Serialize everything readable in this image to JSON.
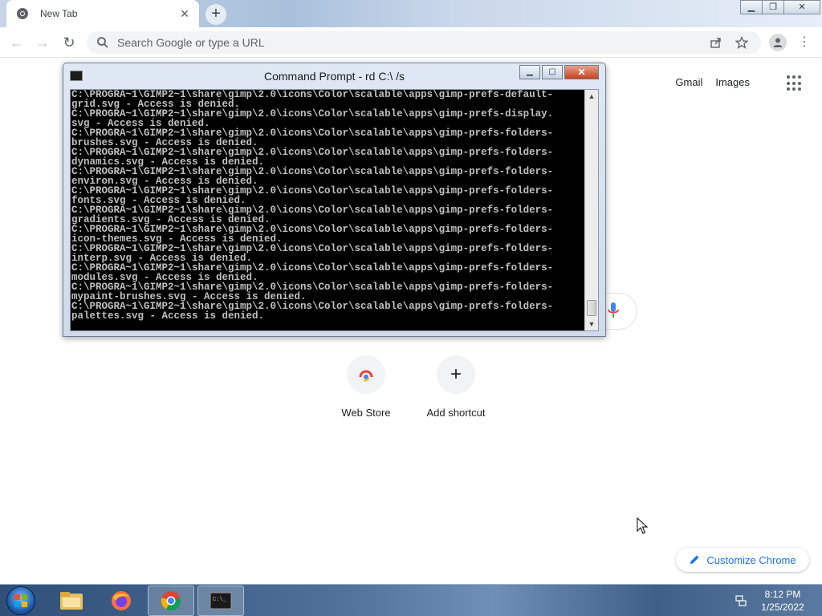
{
  "browser": {
    "tab": {
      "title": "New Tab"
    },
    "omnibox": {
      "placeholder": "Search Google or type a URL"
    },
    "colors": {
      "accent": "#1a73e8",
      "tab_bg": "#ffffff",
      "omnibox_bg": "#f1f3f4"
    }
  },
  "ntp": {
    "links": {
      "gmail": "Gmail",
      "images": "Images"
    },
    "shortcuts": [
      {
        "label": "Web Store",
        "icon": "webstore-icon"
      },
      {
        "label": "Add shortcut",
        "icon": "plus-icon"
      }
    ],
    "customize_label": "Customize Chrome"
  },
  "cmd": {
    "title": "Command Prompt - rd  C:\\ /s",
    "lines": [
      "C:\\PROGRA~1\\GIMP2~1\\share\\gimp\\2.0\\icons\\Color\\scalable\\apps\\gimp-prefs-default-",
      "grid.svg - Access is denied.",
      "C:\\PROGRA~1\\GIMP2~1\\share\\gimp\\2.0\\icons\\Color\\scalable\\apps\\gimp-prefs-display.",
      "svg - Access is denied.",
      "C:\\PROGRA~1\\GIMP2~1\\share\\gimp\\2.0\\icons\\Color\\scalable\\apps\\gimp-prefs-folders-",
      "brushes.svg - Access is denied.",
      "C:\\PROGRA~1\\GIMP2~1\\share\\gimp\\2.0\\icons\\Color\\scalable\\apps\\gimp-prefs-folders-",
      "dynamics.svg - Access is denied.",
      "C:\\PROGRA~1\\GIMP2~1\\share\\gimp\\2.0\\icons\\Color\\scalable\\apps\\gimp-prefs-folders-",
      "environ.svg - Access is denied.",
      "C:\\PROGRA~1\\GIMP2~1\\share\\gimp\\2.0\\icons\\Color\\scalable\\apps\\gimp-prefs-folders-",
      "fonts.svg - Access is denied.",
      "C:\\PROGRA~1\\GIMP2~1\\share\\gimp\\2.0\\icons\\Color\\scalable\\apps\\gimp-prefs-folders-",
      "gradients.svg - Access is denied.",
      "C:\\PROGRA~1\\GIMP2~1\\share\\gimp\\2.0\\icons\\Color\\scalable\\apps\\gimp-prefs-folders-",
      "icon-themes.svg - Access is denied.",
      "C:\\PROGRA~1\\GIMP2~1\\share\\gimp\\2.0\\icons\\Color\\scalable\\apps\\gimp-prefs-folders-",
      "interp.svg - Access is denied.",
      "C:\\PROGRA~1\\GIMP2~1\\share\\gimp\\2.0\\icons\\Color\\scalable\\apps\\gimp-prefs-folders-",
      "modules.svg - Access is denied.",
      "C:\\PROGRA~1\\GIMP2~1\\share\\gimp\\2.0\\icons\\Color\\scalable\\apps\\gimp-prefs-folders-",
      "mypaint-brushes.svg - Access is denied.",
      "C:\\PROGRA~1\\GIMP2~1\\share\\gimp\\2.0\\icons\\Color\\scalable\\apps\\gimp-prefs-folders-",
      "palettes.svg - Access is denied."
    ]
  },
  "taskbar": {
    "items": [
      {
        "name": "explorer",
        "icon": "folder-icon",
        "active": false
      },
      {
        "name": "firefox",
        "icon": "firefox-icon",
        "active": false
      },
      {
        "name": "chrome",
        "icon": "chrome-icon",
        "active": true
      },
      {
        "name": "cmd",
        "icon": "cmd-icon",
        "active": true
      }
    ],
    "clock": {
      "time": "8:12 PM",
      "date": "1/25/2022"
    }
  }
}
